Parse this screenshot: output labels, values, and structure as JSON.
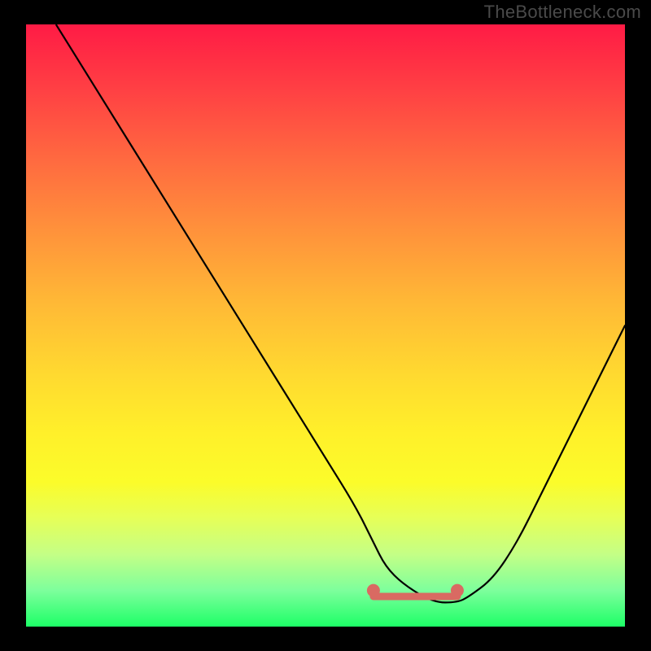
{
  "watermark": "TheBottleneck.com",
  "chart_data": {
    "type": "line",
    "title": "",
    "xlabel": "",
    "ylabel": "",
    "xlim": [
      0,
      100
    ],
    "ylim": [
      0,
      100
    ],
    "grid": false,
    "background_gradient": {
      "orientation": "vertical",
      "stops": [
        {
          "pos": 0,
          "color": "#ff1b45"
        },
        {
          "pos": 50,
          "color": "#ffd02e"
        },
        {
          "pos": 100,
          "color": "#1dff67"
        }
      ]
    },
    "series": [
      {
        "name": "bottleneck-curve",
        "color": "#000000",
        "x": [
          5,
          10,
          15,
          20,
          25,
          30,
          35,
          40,
          45,
          50,
          55,
          58,
          60,
          63,
          68,
          72,
          74,
          78,
          82,
          86,
          90,
          95,
          100
        ],
        "y": [
          100,
          92,
          84,
          76,
          68,
          60,
          52,
          44,
          36,
          28,
          20,
          14,
          10,
          7,
          4,
          4,
          5,
          8,
          14,
          22,
          30,
          40,
          50
        ]
      }
    ],
    "optimal_zone": {
      "name": "flat-optimal-segment",
      "color": "#d96a62",
      "x_start": 58,
      "x_end": 72,
      "y": 5,
      "endpoints": [
        {
          "x": 58,
          "y": 6
        },
        {
          "x": 72,
          "y": 6
        }
      ]
    }
  }
}
